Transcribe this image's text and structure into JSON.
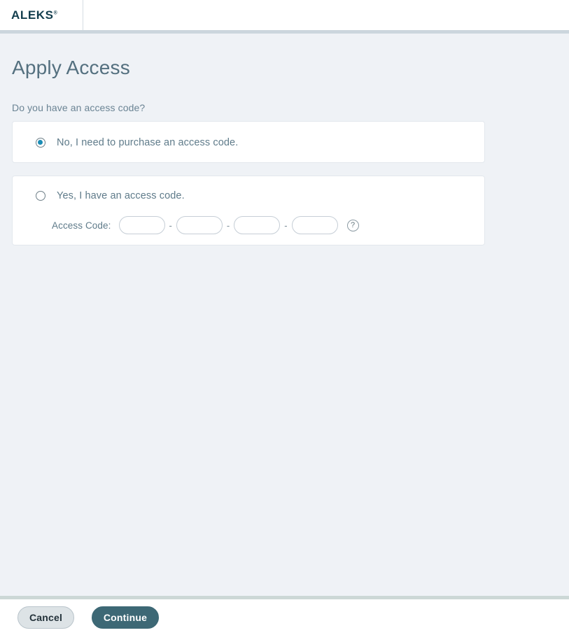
{
  "header": {
    "logo_text": "ALEKS",
    "logo_registered": "®"
  },
  "main": {
    "page_title": "Apply Access",
    "question": "Do you have an access code?",
    "options": [
      {
        "id": "no-purchase",
        "label": "No, I need to purchase an access code.",
        "selected": true
      },
      {
        "id": "yes-have-code",
        "label": "Yes, I have an access code.",
        "selected": false
      }
    ],
    "access_code": {
      "label": "Access Code:",
      "separator": "-",
      "segments": [
        {
          "value": "",
          "placeholder": ""
        },
        {
          "value": "",
          "placeholder": ""
        },
        {
          "value": "",
          "placeholder": ""
        },
        {
          "value": "",
          "placeholder": ""
        }
      ],
      "help_icon": "?"
    }
  },
  "footer": {
    "cancel_label": "Cancel",
    "continue_label": "Continue"
  },
  "colors": {
    "page_background": "#eff2f6",
    "header_background": "#ffffff",
    "card_background": "#ffffff",
    "title_text": "#54707f",
    "body_text": "#5f7b8a",
    "logo": "#123d4d",
    "radio_accent": "#1b8cb5",
    "continue_button": "#3d6875",
    "cancel_button": "#dde3e6",
    "rule": "#ccd6dd"
  }
}
